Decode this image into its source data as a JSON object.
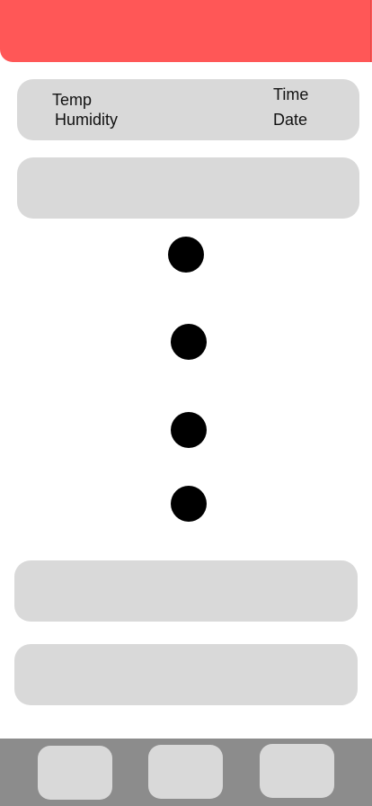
{
  "colors": {
    "header": "#ff5757",
    "card": "#d9d9d9",
    "bottom_bar": "#8c8c8c",
    "dot": "#000000"
  },
  "info_card": {
    "temp_label": "Temp",
    "humidity_label": "Humidity",
    "time_label": "Time",
    "date_label": "Date"
  }
}
